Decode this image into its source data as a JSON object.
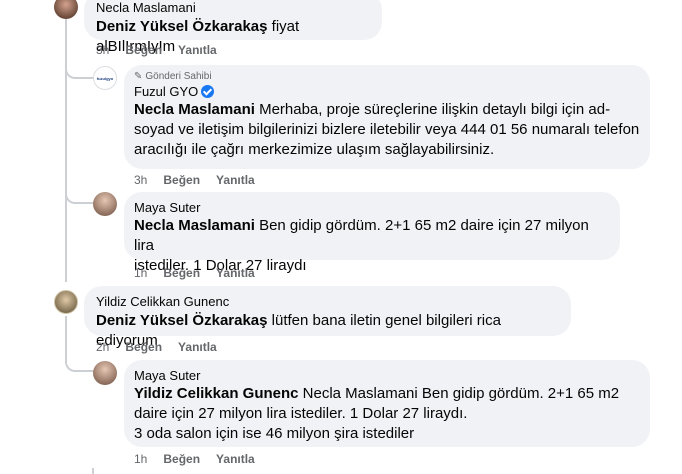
{
  "comments": [
    {
      "author": "Necla Maslamani",
      "mention": "Deniz Yüksel Özkarakaş",
      "text": " fiyat alBIlIrmIyIm",
      "time": "3h",
      "like": "Beğen",
      "reply": "Yanıtla"
    },
    {
      "owner_label": "Gönderi Sahibi",
      "author": "Fuzul GYO",
      "verified": true,
      "avatar_text": "fuzulgyo",
      "mention": "Necla Maslamani",
      "lines": [
        " Merhaba, proje süreçlerine ilişkin detaylı bilgi için ad-",
        "soyad ve iletişim bilgilerinizi bizlere iletebilir veya 444 01 56 numaralı telefon",
        "aracılığı ile çağrı merkezimize ulaşım sağlayabilirsiniz."
      ],
      "time": "3h",
      "like": "Beğen",
      "reply": "Yanıtla"
    },
    {
      "author": "Maya Suter",
      "mention": "Necla Maslamani",
      "lines": [
        " Ben gidip gördüm. 2+1 65 m2 daire için 27 milyon lira",
        "istediler. 1 Dolar 27 liraydı"
      ],
      "time": "1h",
      "like": "Beğen",
      "reply": "Yanıtla"
    },
    {
      "author": "Yildiz Celikkan Gunenc",
      "mention": "Deniz Yüksel Özkarakaş",
      "text": " lütfen bana iletin genel bilgileri rica ediyorum",
      "time": "2h",
      "like": "Beğen",
      "reply": "Yanıtla"
    },
    {
      "author": "Maya Suter",
      "mention": "Yildiz Celikkan Gunenc",
      "lines": [
        " Necla Maslamani Ben gidip gördüm. 2+1 65 m2",
        "daire için 27 milyon lira istediler. 1 Dolar 27 liraydı.",
        "3 oda salon için ise 46 milyon şira istediler"
      ],
      "time": "1h",
      "like": "Beğen",
      "reply": "Yanıtla"
    }
  ],
  "colors": {
    "bubble": "#f0f2f5",
    "thread_line": "#ccd0d5",
    "meta": "#65676b",
    "verified": "#1877f2"
  }
}
